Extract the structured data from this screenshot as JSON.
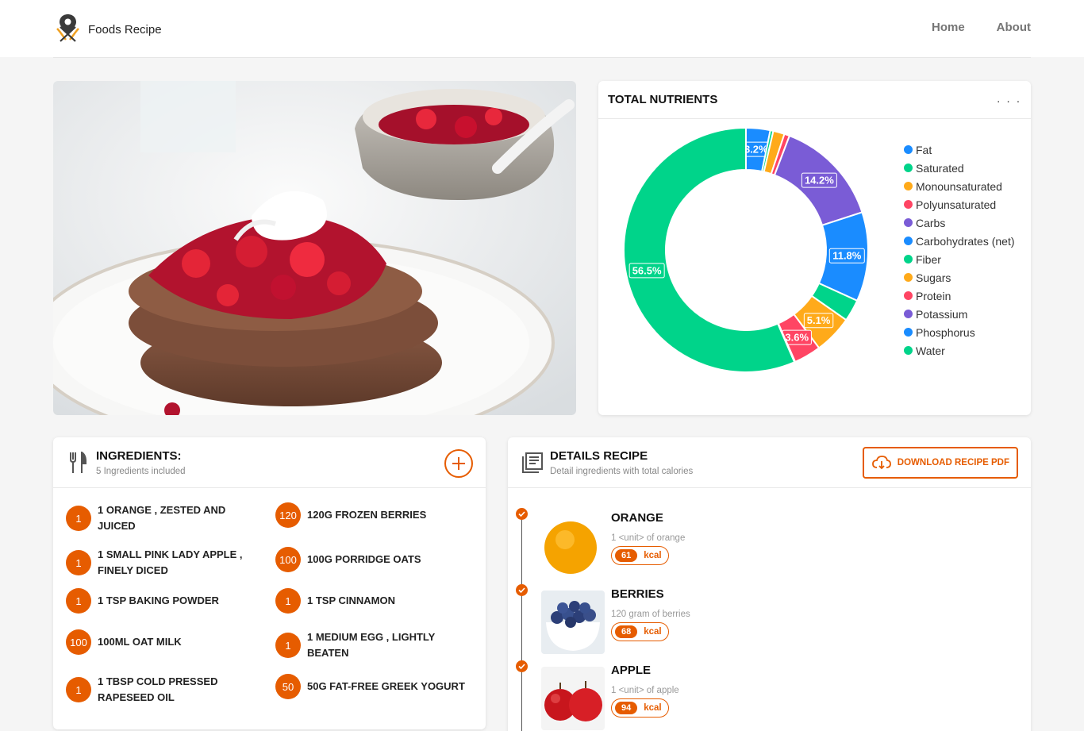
{
  "header": {
    "brand": "Foods Recipe",
    "nav": [
      "Home",
      "About"
    ]
  },
  "nutrients": {
    "title": "TOTAL NUTRIENTS",
    "more": ". . .",
    "legend": [
      {
        "label": "Fat",
        "color": "#1a8cff"
      },
      {
        "label": "Saturated",
        "color": "#00d48a"
      },
      {
        "label": "Monounsaturated",
        "color": "#ffaa1a"
      },
      {
        "label": "Polyunsaturated",
        "color": "#ff4563"
      },
      {
        "label": "Carbs",
        "color": "#7a5cd6"
      },
      {
        "label": "Carbohydrates (net)",
        "color": "#1a8cff"
      },
      {
        "label": "Fiber",
        "color": "#00d48a"
      },
      {
        "label": "Sugars",
        "color": "#ffaa1a"
      },
      {
        "label": "Protein",
        "color": "#ff4563"
      },
      {
        "label": "Potassium",
        "color": "#7a5cd6"
      },
      {
        "label": "Phosphorus",
        "color": "#1a8cff"
      },
      {
        "label": "Water",
        "color": "#00d48a"
      }
    ]
  },
  "chart_data": {
    "type": "pie",
    "donut": true,
    "labels": [
      "Fat",
      "Saturated",
      "Monounsaturated",
      "Polyunsaturated",
      "Carbs",
      "Carbohydrates (net)",
      "Fiber",
      "Sugars",
      "Protein",
      "Potassium",
      "Phosphorus",
      "Water"
    ],
    "values": [
      3.2,
      0.4,
      1.5,
      0.7,
      14.2,
      11.8,
      2.9,
      5.1,
      3.6,
      0.0,
      0.1,
      56.5
    ],
    "data_labels": [
      "3.2%",
      "",
      "",
      "",
      "14.2%",
      "11.8%",
      "",
      "5.1%",
      "3.6%",
      "",
      "",
      "56.5%"
    ],
    "colors": [
      "#1a8cff",
      "#00d48a",
      "#ffaa1a",
      "#ff4563",
      "#7a5cd6",
      "#1a8cff",
      "#00d48a",
      "#ffaa1a",
      "#ff4563",
      "#7a5cd6",
      "#1a8cff",
      "#00d48a"
    ],
    "legend": "right"
  },
  "ingredients": {
    "title": "INGREDIENTS:",
    "subtitle": "5 Ingredients included",
    "items": [
      {
        "qty": "1",
        "text": "1 orange , zested and juiced"
      },
      {
        "qty": "120",
        "text": "120g frozen berries"
      },
      {
        "qty": "1",
        "text": "1 small Pink Lady apple , finely diced"
      },
      {
        "qty": "100",
        "text": "100g porridge oats"
      },
      {
        "qty": "1",
        "text": "1 tsp baking powder"
      },
      {
        "qty": "1",
        "text": "1 tsp cinnamon"
      },
      {
        "qty": "100",
        "text": "100ml oat milk"
      },
      {
        "qty": "1",
        "text": "1 medium egg , lightly beaten"
      },
      {
        "qty": "1",
        "text": "1 tbsp cold pressed rapeseed oil"
      },
      {
        "qty": "50",
        "text": "50g fat-free Greek yogurt"
      }
    ]
  },
  "details": {
    "title": "DETAILS RECIPE",
    "subtitle": "Detail ingredients with total calories",
    "download": "DOWNLOAD RECIPE PDF",
    "items": [
      {
        "name": "ORANGE",
        "sub": "1 <unit> of orange",
        "kcal": "61",
        "unit": "kcal"
      },
      {
        "name": "BERRIES",
        "sub": "120 gram of berries",
        "kcal": "68",
        "unit": "kcal"
      },
      {
        "name": "APPLE",
        "sub": "1 <unit> of apple",
        "kcal": "94",
        "unit": "kcal"
      }
    ]
  }
}
